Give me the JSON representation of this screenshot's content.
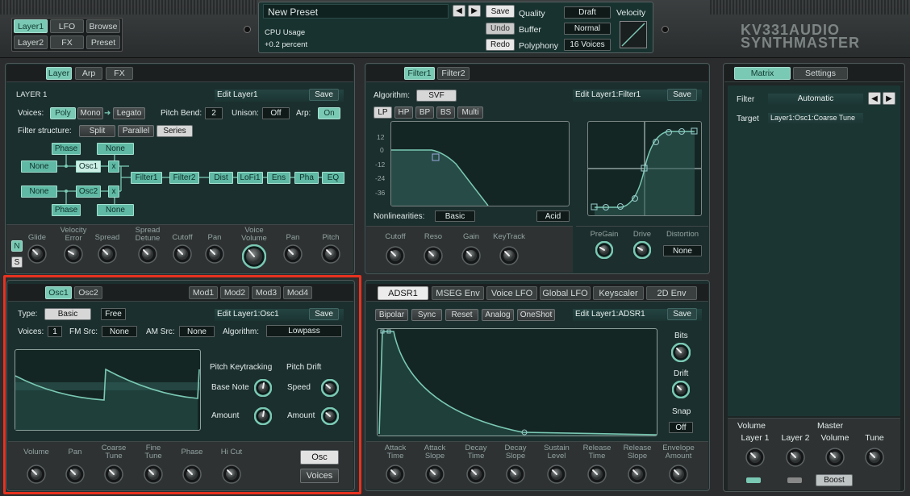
{
  "topbar": {
    "left_tabs": [
      [
        "Layer1",
        "LFO",
        "Browse"
      ],
      [
        "Layer2",
        "FX",
        "Preset"
      ]
    ],
    "preset_name": "New Preset",
    "save": "Save",
    "undo": "Undo",
    "redo": "Redo",
    "cpu_label": "CPU Usage",
    "cpu_value": "+0.2 percent",
    "quality_label": "Quality",
    "quality_value": "Draft",
    "buffer_label": "Buffer",
    "buffer_value": "Normal",
    "polyphony_label": "Polyphony",
    "polyphony_value": "16 Voices",
    "velocity_label": "Velocity",
    "logo_line1": "KV331AUDIO",
    "logo_line2": "SYNTHMASTER"
  },
  "layer_panel": {
    "tabs": [
      "Layer",
      "Arp",
      "FX"
    ],
    "title": "LAYER 1",
    "edit": "Edit Layer1",
    "save": "Save",
    "voices_label": "Voices:",
    "poly": "Poly",
    "mono": "Mono",
    "legato": "Legato",
    "pitchbend_label": "Pitch Bend:",
    "pitchbend_value": "2",
    "unison_label": "Unison:",
    "unison_value": "Off",
    "arp_label": "Arp:",
    "arp_value": "On",
    "filter_structure_label": "Filter structure:",
    "split": "Split",
    "parallel": "Parallel",
    "series": "Series",
    "nodes": {
      "phase1": "Phase",
      "none1": "None",
      "none_a": "None",
      "osc1": "Osc1",
      "x": "x",
      "filter1": "Filter1",
      "filter2": "Filter2",
      "dist": "Dist",
      "lofi1": "LoFi1",
      "ens": "Ens",
      "pha": "Pha",
      "eq": "EQ",
      "none_b": "None",
      "osc2": "Osc2",
      "phase2": "Phase",
      "none2": "None"
    },
    "n": "N",
    "s": "S",
    "knobs": [
      "Glide",
      "Velocity\nError",
      "Spread",
      "Spread\nDetune",
      "Cutoff",
      "Pan",
      "Voice\nVolume",
      "Pan",
      "Pitch"
    ]
  },
  "filter_panel": {
    "tabs": [
      "Filter1",
      "Filter2"
    ],
    "algorithm_label": "Algorithm:",
    "algorithm_value": "SVF",
    "edit": "Edit Layer1:Filter1",
    "save": "Save",
    "types": [
      "LP",
      "HP",
      "BP",
      "BS",
      "Multi"
    ],
    "yticks": [
      "12",
      "0",
      "-12",
      "-24",
      "-36"
    ],
    "nonlin_label": "Nonlinearities:",
    "nonlin_value": "Basic",
    "acid": "Acid",
    "knobs": [
      "Cutoff",
      "Reso",
      "Gain",
      "KeyTrack"
    ],
    "dist_knobs": [
      "PreGain",
      "Drive",
      "Distortion"
    ],
    "distortion_value": "None"
  },
  "matrix_panel": {
    "tabs": [
      "Matrix",
      "Settings"
    ],
    "filter_label": "Filter",
    "filter_value": "Automatic",
    "target_label": "Target",
    "target_value": "Layer1:Osc1:Coarse Tune",
    "volume_label": "Volume",
    "master_label": "Master",
    "knobs": [
      "Layer 1",
      "Layer 2",
      "Volume",
      "Tune"
    ],
    "boost": "Boost"
  },
  "osc_panel": {
    "tabs": [
      "Osc1",
      "Osc2"
    ],
    "mod_tabs": [
      "Mod1",
      "Mod2",
      "Mod3",
      "Mod4"
    ],
    "type_label": "Type:",
    "type_value": "Basic",
    "free": "Free",
    "edit": "Edit Layer1:Osc1",
    "save": "Save",
    "voices_label": "Voices:",
    "voices_value": "1",
    "fm_label": "FM Src:",
    "fm_value": "None",
    "am_label": "AM Src:",
    "am_value": "None",
    "algo_label": "Algorithm:",
    "algo_value": "Lowpass",
    "pitch_keytracking": "Pitch Keytracking",
    "base_note": "Base Note",
    "amount1": "Amount",
    "pitch_drift": "Pitch Drift",
    "speed": "Speed",
    "amount2": "Amount",
    "knobs": [
      "Volume",
      "Pan",
      "Coarse\nTune",
      "Fine\nTune",
      "Phase",
      "Hi Cut"
    ],
    "osc_btn": "Osc",
    "voices_btn": "Voices"
  },
  "env_panel": {
    "tabs": [
      "ADSR1",
      "MSEG Env",
      "Voice LFO",
      "Global LFO",
      "Keyscaler",
      "2D Env"
    ],
    "options": [
      "Bipolar",
      "Sync",
      "Reset",
      "Analog",
      "OneShot"
    ],
    "edit": "Edit Layer1:ADSR1",
    "save": "Save",
    "bits": "Bits",
    "drift": "Drift",
    "snap": "Snap",
    "snap_value": "Off",
    "knobs": [
      "Attack\nTime",
      "Attack\nSlope",
      "Decay\nTime",
      "Decay\nSlope",
      "Sustain\nLevel",
      "Release\nTime",
      "Release\nSlope",
      "Envelope\nAmount"
    ]
  }
}
